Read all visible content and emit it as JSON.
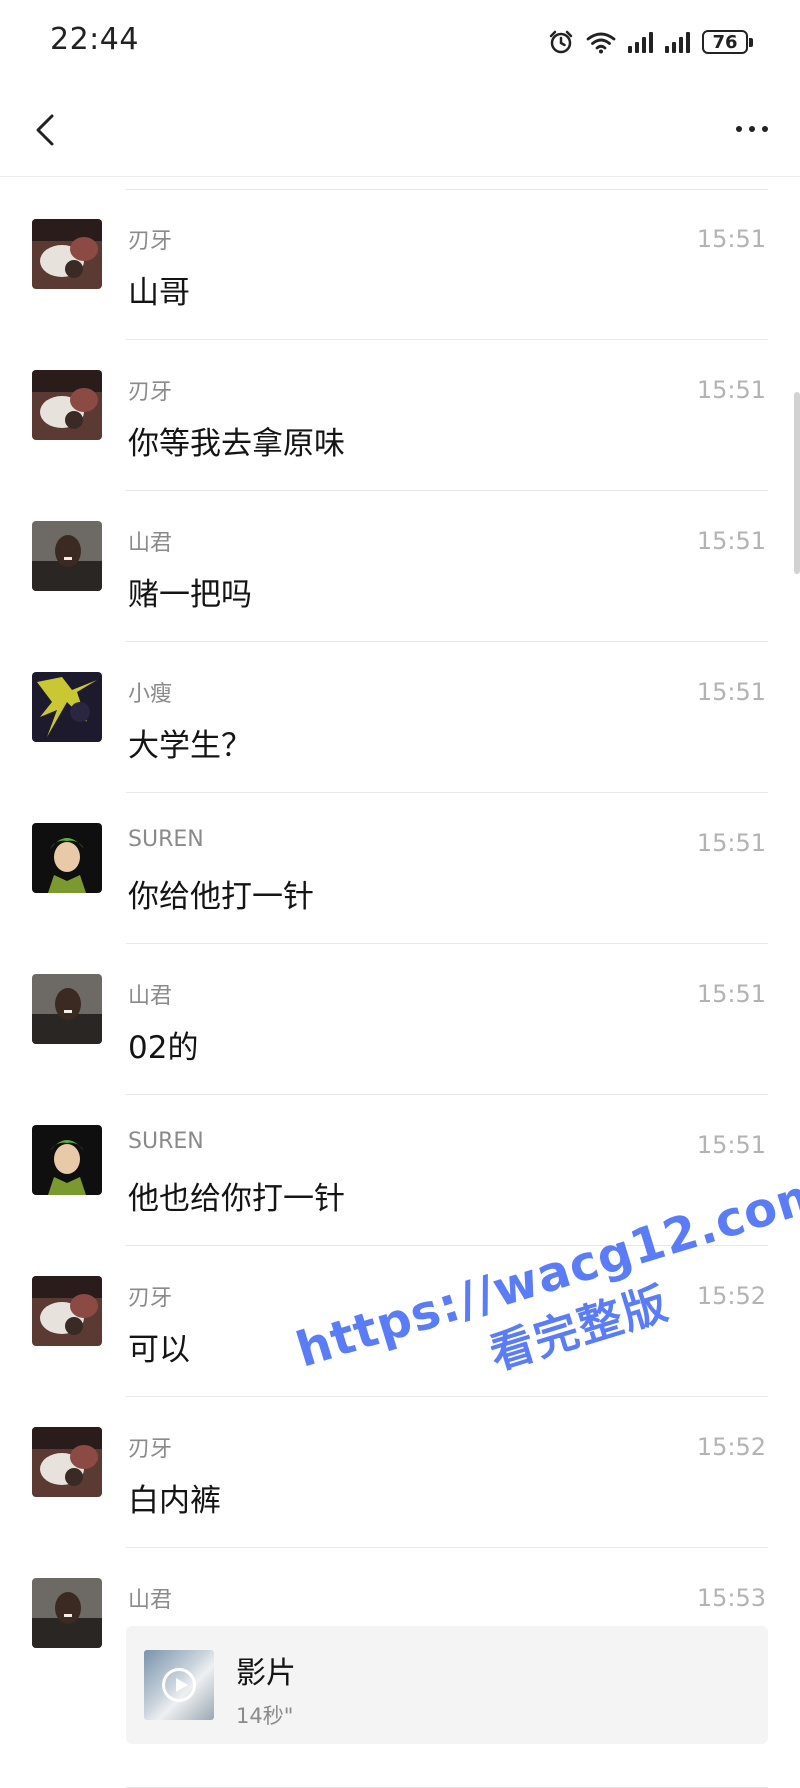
{
  "status_bar": {
    "time": "22:44",
    "battery": "76"
  },
  "messages": [
    {
      "sender": "刃牙",
      "time": "15:51",
      "text": "山哥",
      "avatar": "avatar-renya"
    },
    {
      "sender": "刃牙",
      "time": "15:51",
      "text": "你等我去拿原味",
      "avatar": "avatar-renya"
    },
    {
      "sender": "山君",
      "time": "15:51",
      "text": "赌一把吗",
      "avatar": "avatar-shanjun"
    },
    {
      "sender": "小瘦",
      "time": "15:51",
      "text": "大学生？",
      "avatar": "avatar-xiaoshou"
    },
    {
      "sender": "SUREN",
      "time": "15:51",
      "text": "你给他打一针",
      "avatar": "avatar-suren"
    },
    {
      "sender": "山君",
      "time": "15:51",
      "text": "02的",
      "avatar": "avatar-shanjun"
    },
    {
      "sender": "SUREN",
      "time": "15:51",
      "text": "他也给你打一针",
      "avatar": "avatar-suren"
    },
    {
      "sender": "刃牙",
      "time": "15:52",
      "text": "可以",
      "avatar": "avatar-renya"
    },
    {
      "sender": "刃牙",
      "time": "15:52",
      "text": "白内裤",
      "avatar": "avatar-renya"
    },
    {
      "sender": "山君",
      "time": "15:53",
      "text": "",
      "avatar": "avatar-shanjun",
      "video": {
        "title": "影片",
        "duration": "14秒\""
      }
    }
  ],
  "watermark": {
    "line1": "https://wacg12.com",
    "line2": "看完整版"
  },
  "colors": {
    "watermark": "#5b7cf7",
    "divider": "#e8e8e8",
    "sender": "#8a8a8a",
    "time": "#b3b3b3"
  },
  "icons": {
    "back": "chevron-left-icon",
    "more": "more-dots-icon",
    "alarm": "alarm-clock-icon",
    "wifi": "wifi-icon",
    "signal": "signal-icon"
  }
}
